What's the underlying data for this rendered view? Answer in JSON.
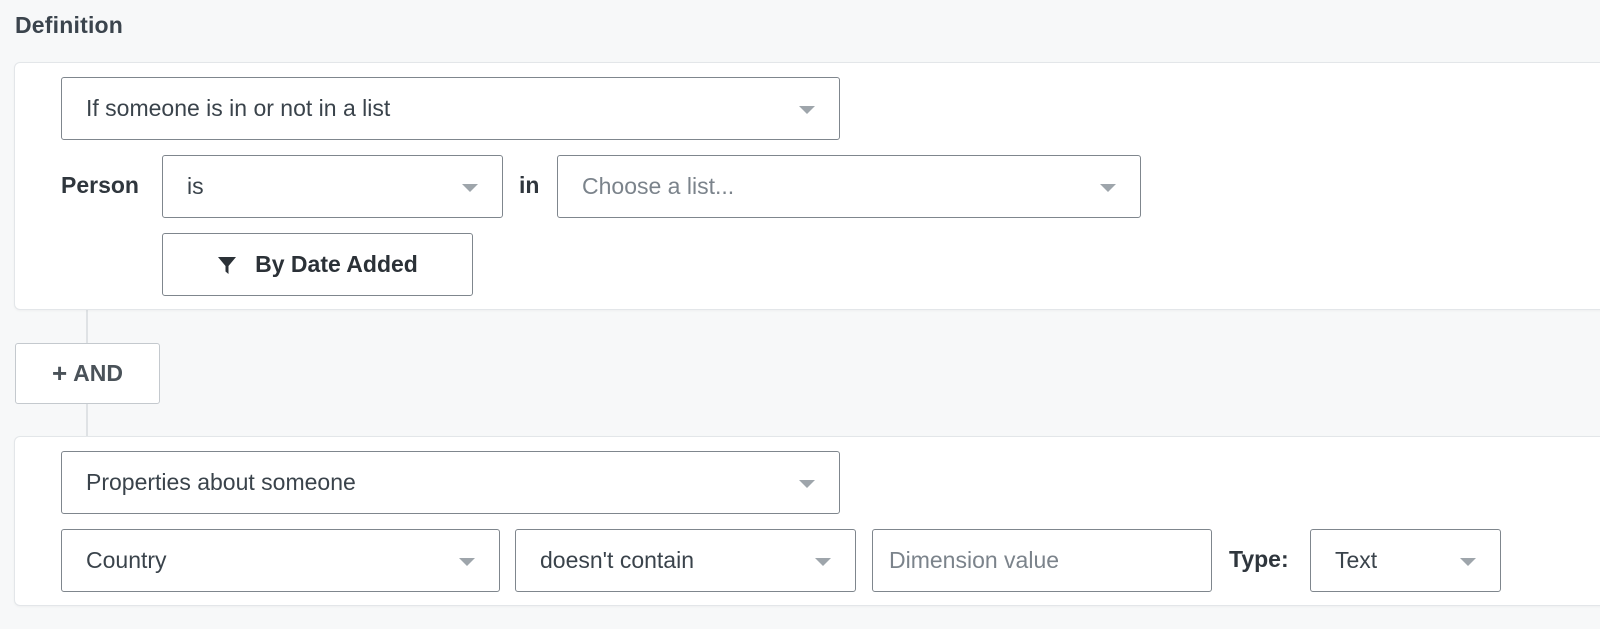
{
  "section_title": "Definition",
  "condition_1": {
    "type_select": "If someone is in or not in a list",
    "subject_label": "Person",
    "operator_select": "is",
    "preposition_label": "in",
    "list_select_placeholder": "Choose a list...",
    "filter_button_label": "By Date Added",
    "filter_button_icon": "filter-icon"
  },
  "and_button": {
    "plus": "+",
    "label": "AND"
  },
  "condition_2": {
    "type_select": "Properties about someone",
    "property_select": "Country",
    "operator_select": "doesn't contain",
    "value_placeholder": "Dimension value",
    "type_label": "Type:",
    "type_select_value": "Text"
  }
}
